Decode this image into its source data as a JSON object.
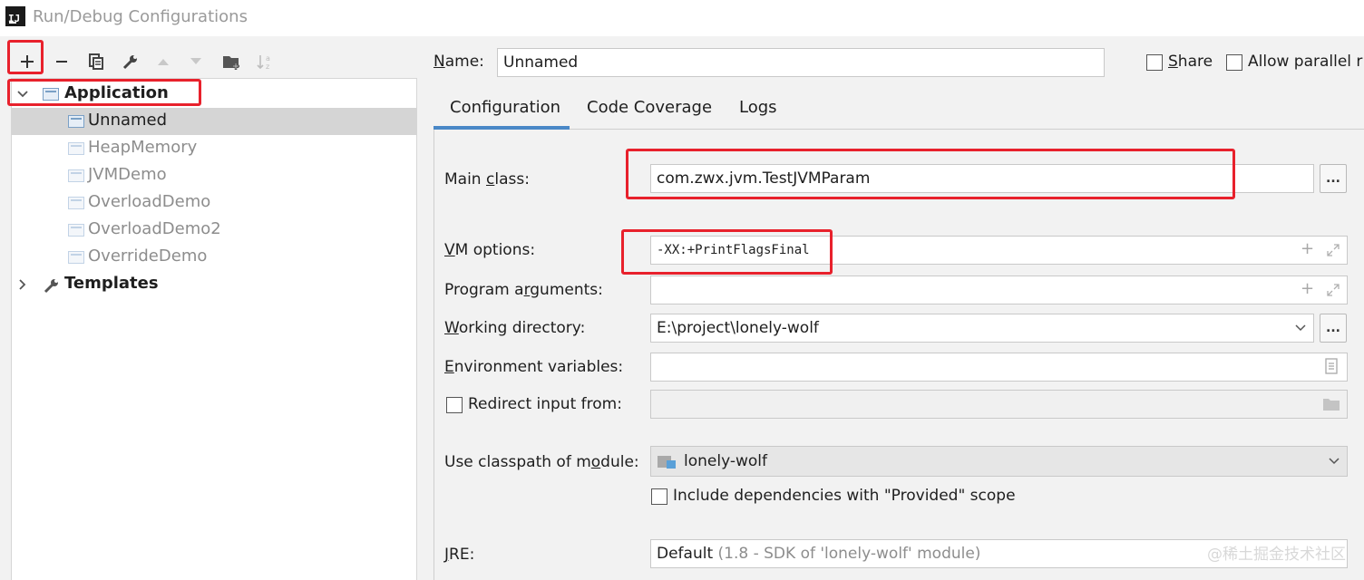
{
  "window": {
    "title": "Run/Debug Configurations"
  },
  "toolbar": {
    "add_label": "+",
    "remove_label": "−",
    "icons": [
      "add-icon",
      "remove-icon",
      "copy-icon",
      "wrench-icon",
      "move-up-icon",
      "move-down-icon",
      "folder-add-icon",
      "sort-icon"
    ]
  },
  "tree": {
    "application": {
      "label": "Application"
    },
    "items": [
      {
        "label": "Unnamed"
      },
      {
        "label": "HeapMemory"
      },
      {
        "label": "JVMDemo"
      },
      {
        "label": "OverloadDemo"
      },
      {
        "label": "OverloadDemo2"
      },
      {
        "label": "OverrideDemo"
      }
    ],
    "templates": {
      "label": "Templates"
    }
  },
  "header": {
    "name_label_prefix": "N",
    "name_label_rest": "ame:",
    "name_value": "Unnamed",
    "share_label_prefix": "S",
    "share_label_rest": "hare",
    "allow_parallel_label": "Allow parallel r"
  },
  "tabs": [
    {
      "label": "Configuration"
    },
    {
      "label": "Code Coverage"
    },
    {
      "label": "Logs"
    }
  ],
  "form": {
    "main_class": {
      "label_a": "Main ",
      "label_u": "c",
      "label_b": "lass:",
      "value": "com.zwx.jvm.TestJVMParam",
      "browse": "..."
    },
    "vm_options": {
      "label_u": "V",
      "label_b": "M options:",
      "value": "-XX:+PrintFlagsFinal"
    },
    "program_arguments": {
      "label_a": "Program a",
      "label_u": "r",
      "label_b": "guments:",
      "value": ""
    },
    "working_directory": {
      "label_u": "W",
      "label_b": "orking directory:",
      "value": "E:\\project\\lonely-wolf",
      "browse": "..."
    },
    "environment_variables": {
      "label_u": "E",
      "label_b": "nvironment variables:",
      "value": ""
    },
    "redirect_input": {
      "label": "Redirect input from:",
      "value": ""
    },
    "classpath_module": {
      "label_a": "Use classpath of m",
      "label_u": "o",
      "label_b": "dule:",
      "value": "lonely-wolf"
    },
    "include_dependencies": {
      "label": "Include dependencies with \"Provided\" scope"
    },
    "jre": {
      "label_u": "J",
      "label_b": "RE:",
      "value": "Default",
      "hint": "(1.8 - SDK of 'lonely-wolf' module)"
    }
  },
  "watermark": "@稀土掘金技术社区",
  "colors": {
    "highlight_box": "#e8212c",
    "tab_accent": "#4a88c7"
  }
}
